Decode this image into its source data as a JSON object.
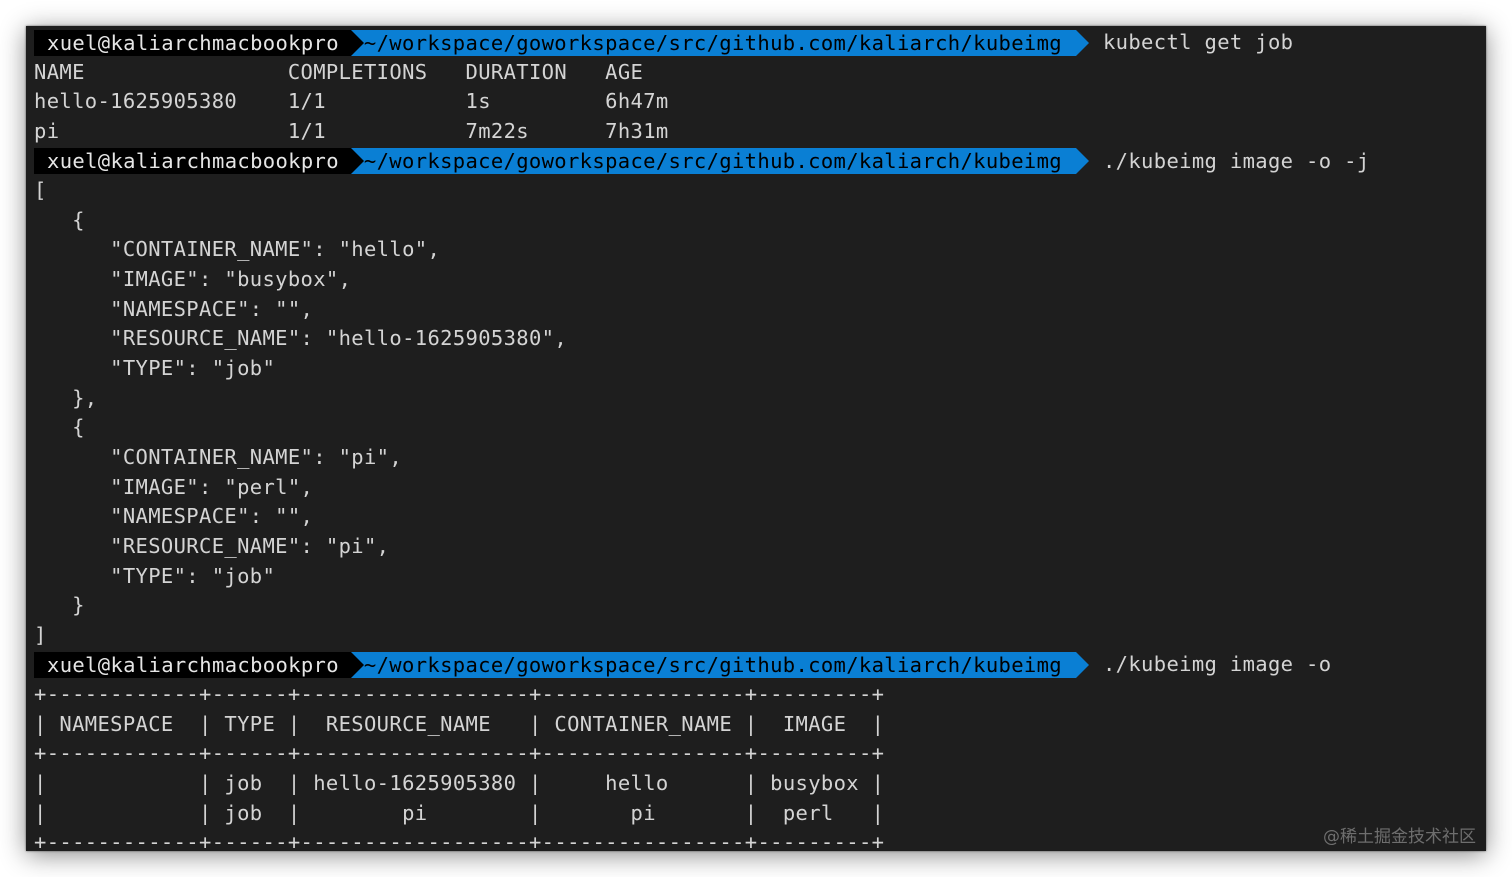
{
  "prompts": [
    {
      "user": "xuel@kaliarchmacbookpro",
      "path": "~/workspace/goworkspace/src/github.com/kaliarch/kubeimg",
      "command": "kubectl get job"
    },
    {
      "user": "xuel@kaliarchmacbookpro",
      "path": "~/workspace/goworkspace/src/github.com/kaliarch/kubeimg",
      "command": "./kubeimg image -o -j"
    },
    {
      "user": "xuel@kaliarchmacbookpro",
      "path": "~/workspace/goworkspace/src/github.com/kaliarch/kubeimg",
      "command": "./kubeimg image -o"
    }
  ],
  "kubectl_output": [
    "NAME                COMPLETIONS   DURATION   AGE",
    "hello-1625905380    1/1           1s         6h47m",
    "pi                  1/1           7m22s      7h31m"
  ],
  "json_output": [
    "[",
    "   {",
    "      \"CONTAINER_NAME\": \"hello\",",
    "      \"IMAGE\": \"busybox\",",
    "      \"NAMESPACE\": \"\",",
    "      \"RESOURCE_NAME\": \"hello-1625905380\",",
    "      \"TYPE\": \"job\"",
    "   },",
    "   {",
    "      \"CONTAINER_NAME\": \"pi\",",
    "      \"IMAGE\": \"perl\",",
    "      \"NAMESPACE\": \"\",",
    "      \"RESOURCE_NAME\": \"pi\",",
    "      \"TYPE\": \"job\"",
    "   }",
    "]"
  ],
  "table_output": [
    "+------------+------+------------------+----------------+---------+",
    "| NAMESPACE  | TYPE |  RESOURCE_NAME   | CONTAINER_NAME |  IMAGE  |",
    "+------------+------+------------------+----------------+---------+",
    "|            | job  | hello-1625905380 |     hello      | busybox |",
    "|            | job  |        pi        |       pi       |  perl   |",
    "+------------+------+------------------+----------------+---------+"
  ],
  "watermark": "@稀土掘金技术社区",
  "colors": {
    "background": "#1e1e1e",
    "text": "#d4d4d4",
    "prompt_user_bg": "#000000",
    "prompt_path_bg": "#0a7fd4"
  }
}
